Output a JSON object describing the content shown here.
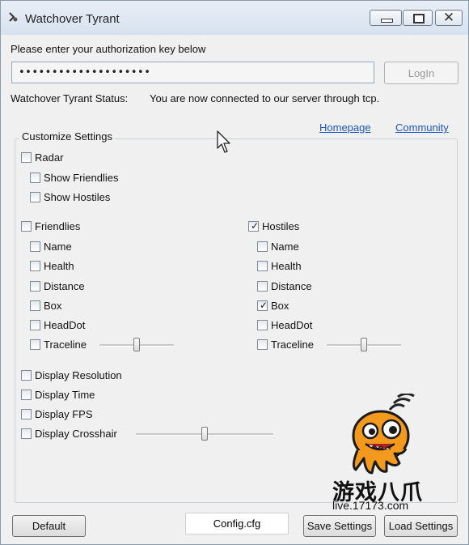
{
  "window": {
    "title": "Watchover Tyrant",
    "close_glyph": "✕"
  },
  "auth": {
    "prompt": "Please enter your authorization key below",
    "key_value": "••••••••••••••••••••",
    "login_label": "LogIn"
  },
  "status": {
    "label": "Watchover Tyrant Status:",
    "value": "You are now connected to our server through tcp."
  },
  "links": {
    "homepage": "Homepage",
    "community": "Community"
  },
  "settings": {
    "group_title": "Customize Settings",
    "radar": {
      "label": "Radar",
      "checked": false
    },
    "radar_show_friendlies": {
      "label": "Show Friendlies",
      "checked": false
    },
    "radar_show_hostiles": {
      "label": "Show Hostiles",
      "checked": false
    },
    "friendlies": {
      "label": "Friendlies",
      "checked": false,
      "options": [
        {
          "label": "Name",
          "checked": false
        },
        {
          "label": "Health",
          "checked": false
        },
        {
          "label": "Distance",
          "checked": false
        },
        {
          "label": "Box",
          "checked": false
        },
        {
          "label": "HeadDot",
          "checked": false
        },
        {
          "label": "Traceline",
          "checked": false
        }
      ],
      "traceline_slider": 0.5
    },
    "hostiles": {
      "label": "Hostiles",
      "checked": true,
      "options": [
        {
          "label": "Name",
          "checked": false
        },
        {
          "label": "Health",
          "checked": false
        },
        {
          "label": "Distance",
          "checked": false
        },
        {
          "label": "Box",
          "checked": true
        },
        {
          "label": "HeadDot",
          "checked": false
        },
        {
          "label": "Traceline",
          "checked": false
        }
      ],
      "traceline_slider": 0.5
    },
    "display": [
      {
        "label": "Display Resolution",
        "checked": false
      },
      {
        "label": "Display Time",
        "checked": false
      },
      {
        "label": "Display FPS",
        "checked": false
      },
      {
        "label": "Display Crosshair",
        "checked": false
      }
    ],
    "crosshair_slider": 0.5
  },
  "footer": {
    "default_label": "Default",
    "config_value": "Config.cfg",
    "save_label": "Save Settings",
    "load_label": "Load Settings"
  },
  "watermark": {
    "text": "游戏八爪",
    "url": "live.17173.com"
  },
  "colors": {
    "link": "#1a56c2",
    "mascot_orange": "#f39a1e"
  }
}
